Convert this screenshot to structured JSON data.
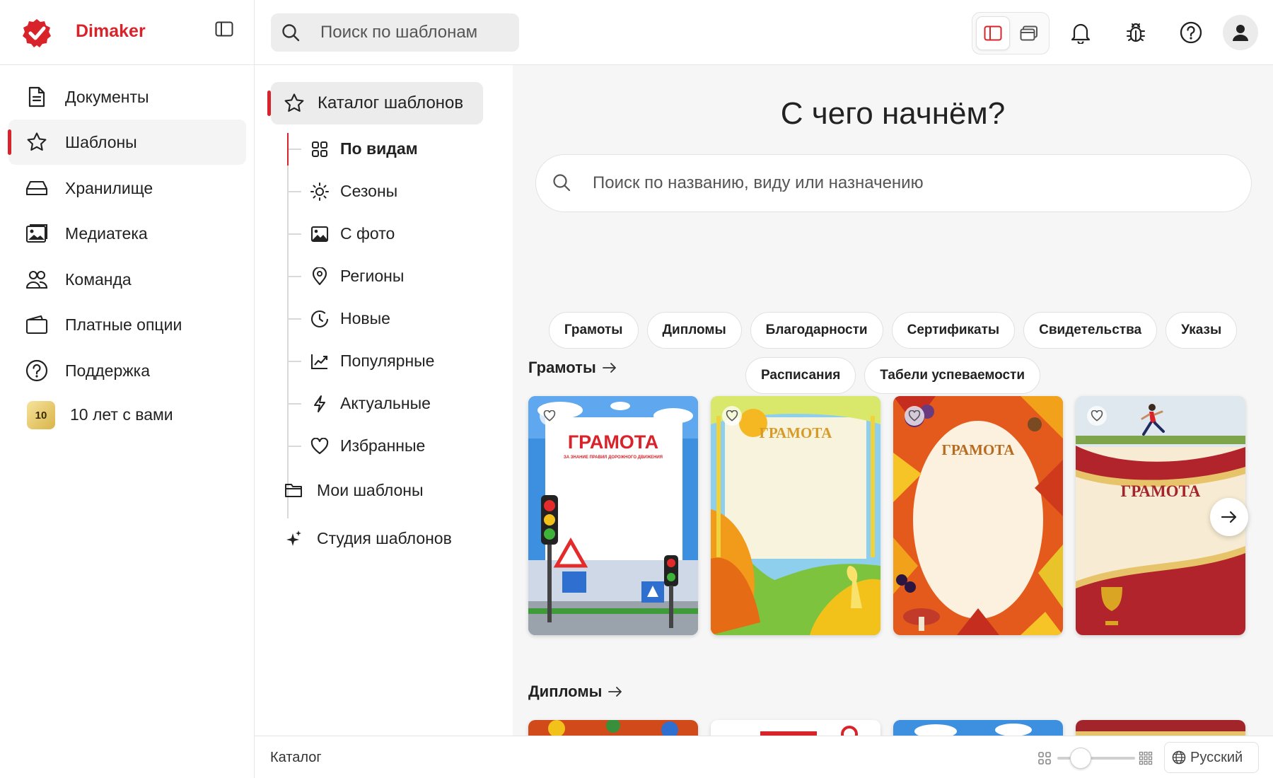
{
  "header": {
    "brand": "Dimaker",
    "search_placeholder": "Поиск по шаблонам"
  },
  "colors": {
    "accent": "#d8232a",
    "main_bg": "#f6f6f6"
  },
  "sidebar": {
    "items": [
      {
        "label": "Документы",
        "icon": "document-icon"
      },
      {
        "label": "Шаблоны",
        "icon": "star-icon",
        "active": true
      },
      {
        "label": "Хранилище",
        "icon": "storage-icon"
      },
      {
        "label": "Медиатека",
        "icon": "media-icon"
      },
      {
        "label": "Команда",
        "icon": "team-icon"
      },
      {
        "label": "Платные опции",
        "icon": "wallet-icon"
      },
      {
        "label": "Поддержка",
        "icon": "help-icon"
      }
    ],
    "anniversary": {
      "badge": "10",
      "label": "10 лет с вами"
    }
  },
  "subnav": {
    "catalog": "Каталог шаблонов",
    "items": [
      {
        "label": "По видам",
        "icon": "grid-icon",
        "active": true
      },
      {
        "label": "Сезоны",
        "icon": "sun-icon"
      },
      {
        "label": "С фото",
        "icon": "image-icon"
      },
      {
        "label": "Регионы",
        "icon": "location-pin-icon"
      },
      {
        "label": "Новые",
        "icon": "clock-icon"
      },
      {
        "label": "Популярные",
        "icon": "trending-chart-icon"
      },
      {
        "label": "Актуальные",
        "icon": "lightning-icon"
      },
      {
        "label": "Избранные",
        "icon": "heart-icon"
      }
    ],
    "my_templates": "Мои шаблоны",
    "studio": "Студия шаблонов"
  },
  "main": {
    "title": "С чего начнём?",
    "search_placeholder": "Поиск по названию, виду или назначению",
    "chips_row1": [
      "Грамоты",
      "Дипломы",
      "Благодарности",
      "Сертификаты",
      "Свидетельства",
      "Указы"
    ],
    "chips_row2": [
      "Расписания",
      "Табели успеваемости"
    ],
    "sections": [
      {
        "title": "Грамоты",
        "cards": [
          {
            "title": "ГРАМОТА",
            "subtitle": "ЗА ЗНАНИЕ ПРАВИЛ ДОРОЖНОГО ДВИЖЕНИЯ",
            "theme": "traffic"
          },
          {
            "title": "ГРАМОТА",
            "theme": "autumn-sun"
          },
          {
            "title": "ГРАМОТА",
            "theme": "autumn-leaves"
          },
          {
            "title": "ГРАМОТА",
            "theme": "sport-red"
          }
        ]
      },
      {
        "title": "Дипломы"
      }
    ]
  },
  "footer": {
    "breadcrumb": "Каталог",
    "zoom_level": 0.3,
    "language": "Русский"
  }
}
